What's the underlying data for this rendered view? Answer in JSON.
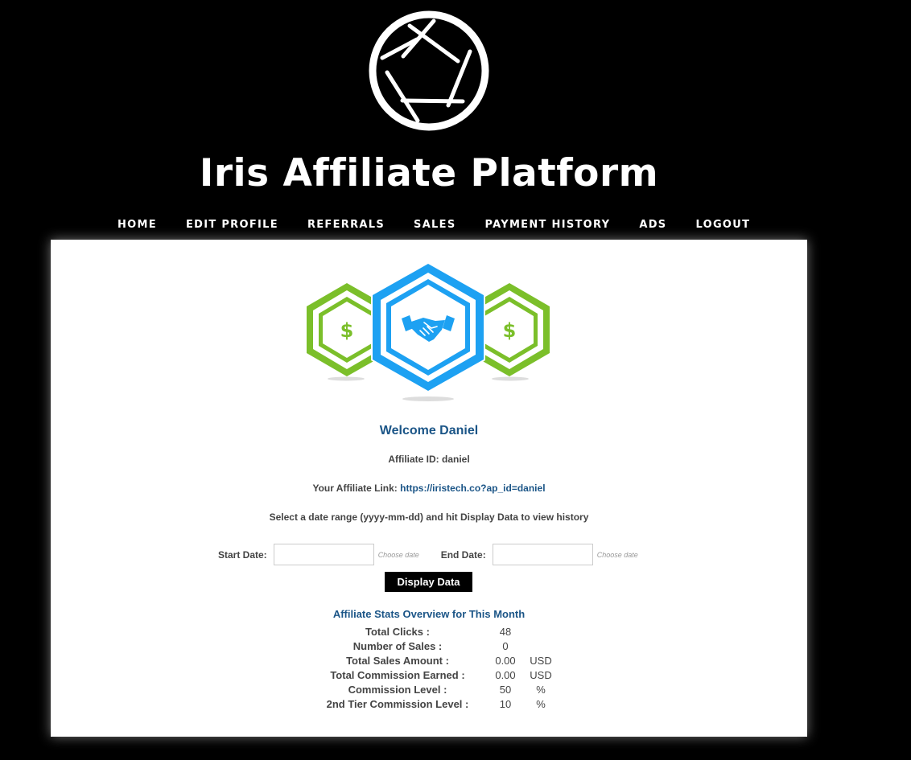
{
  "site": {
    "title": "Iris Affiliate Platform"
  },
  "nav": [
    "HOME",
    "EDIT PROFILE",
    "REFERRALS",
    "SALES",
    "PAYMENT HISTORY",
    "ADS",
    "LOGOUT"
  ],
  "colors": {
    "brand_blue": "#1da1f2",
    "money_green": "#7bbf2a",
    "heading_blue": "#1b5587"
  },
  "welcome": "Welcome Daniel",
  "affiliate_id_line": "Affiliate ID: daniel",
  "affiliate_link": {
    "label": "Your Affiliate Link:",
    "url": "https://iristech.co?ap_id=daniel"
  },
  "instructions": "Select a date range (yyyy-mm-dd) and hit Display Data to view history",
  "filters": {
    "start_label": "Start Date:",
    "end_label": "End Date:",
    "start_value": "",
    "end_value": "",
    "hint": "Choose date",
    "button": "Display Data"
  },
  "stats": {
    "title": "Affiliate Stats Overview for This Month",
    "rows": [
      {
        "label": "Total Clicks :",
        "value": "48",
        "unit": ""
      },
      {
        "label": "Number of Sales :",
        "value": "0",
        "unit": ""
      },
      {
        "label": "Total Sales Amount :",
        "value": "0.00",
        "unit": "USD"
      },
      {
        "label": "Total Commission Earned :",
        "value": "0.00",
        "unit": "USD"
      },
      {
        "label": "Commission Level :",
        "value": "50",
        "unit": "%"
      },
      {
        "label": "2nd Tier Commission Level :",
        "value": "10",
        "unit": "%"
      }
    ]
  },
  "icons": {
    "logo": "camera-aperture-icon",
    "hero": "handshake-hexagon-icon",
    "coin": "dollar-hexagon-icon"
  }
}
